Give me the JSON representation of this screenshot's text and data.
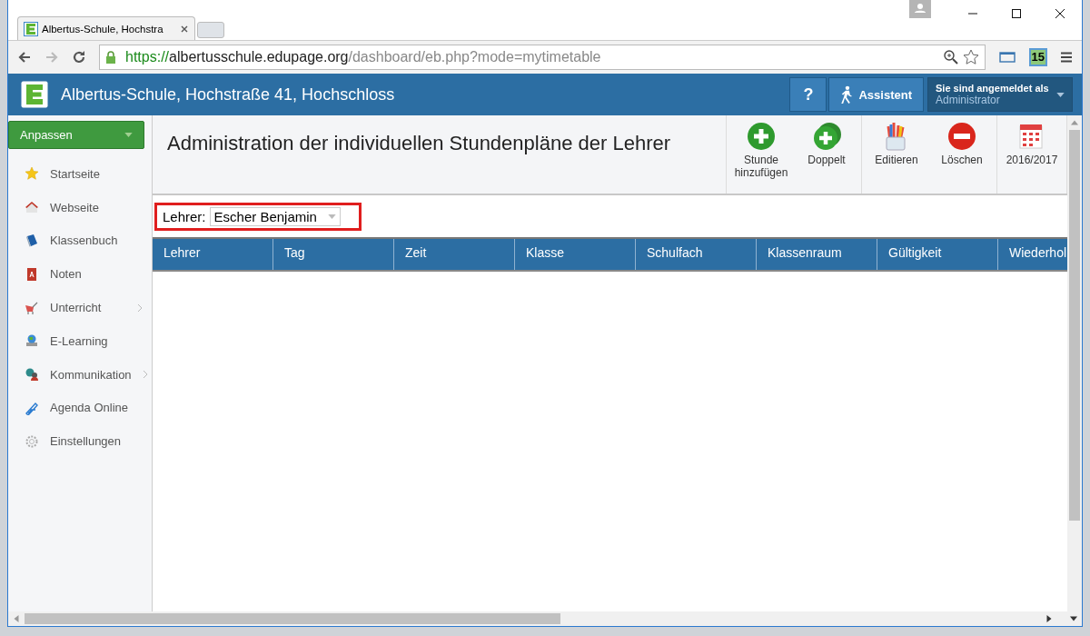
{
  "browser": {
    "tab_title": "Albertus-Schule, Hochstra",
    "url": {
      "scheme": "https://",
      "host": "albertusschule.edupage.org",
      "path": "/dashboard/eb.php?mode=mytimetable"
    },
    "extension_badge": "15"
  },
  "header": {
    "school_name": "Albertus-Schule, Hochstraße 41, Hochschloss",
    "help_label": "?",
    "assistant_label": "Assistent",
    "login": {
      "caption": "Sie sind angemeldet als",
      "user": "Administrator"
    }
  },
  "sidebar": {
    "customize_button": "Anpassen",
    "items": [
      {
        "label": "Startseite",
        "kind": "star",
        "has_submenu": false
      },
      {
        "label": "Webseite",
        "kind": "house",
        "has_submenu": false
      },
      {
        "label": "Klassenbuch",
        "kind": "book",
        "has_submenu": false
      },
      {
        "label": "Noten",
        "kind": "grades",
        "has_submenu": false
      },
      {
        "label": "Unterricht",
        "kind": "teaching",
        "has_submenu": true
      },
      {
        "label": "E-Learning",
        "kind": "elearning",
        "has_submenu": false
      },
      {
        "label": "Kommunikation",
        "kind": "communication",
        "has_submenu": true
      },
      {
        "label": "Agenda Online",
        "kind": "agenda",
        "has_submenu": false
      },
      {
        "label": "Einstellungen",
        "kind": "settings",
        "has_submenu": false
      }
    ]
  },
  "page": {
    "title": "Administration der individuellen Stundenpläne der Lehrer",
    "action_groups": [
      [
        {
          "label": "Stunde hinzufügen",
          "kind": "add"
        },
        {
          "label": "Doppelt",
          "kind": "duplicate"
        }
      ],
      [
        {
          "label": "Editieren",
          "kind": "edit"
        },
        {
          "label": "Löschen",
          "kind": "delete"
        }
      ],
      [
        {
          "label": "2016/2017",
          "kind": "calendar"
        }
      ]
    ]
  },
  "filter": {
    "label": "Lehrer:",
    "value": "Escher Benjamin"
  },
  "table": {
    "columns": [
      "Lehrer",
      "Tag",
      "Zeit",
      "Klasse",
      "Schulfach",
      "Klassenraum",
      "Gültigkeit",
      "Wiederhol"
    ]
  }
}
